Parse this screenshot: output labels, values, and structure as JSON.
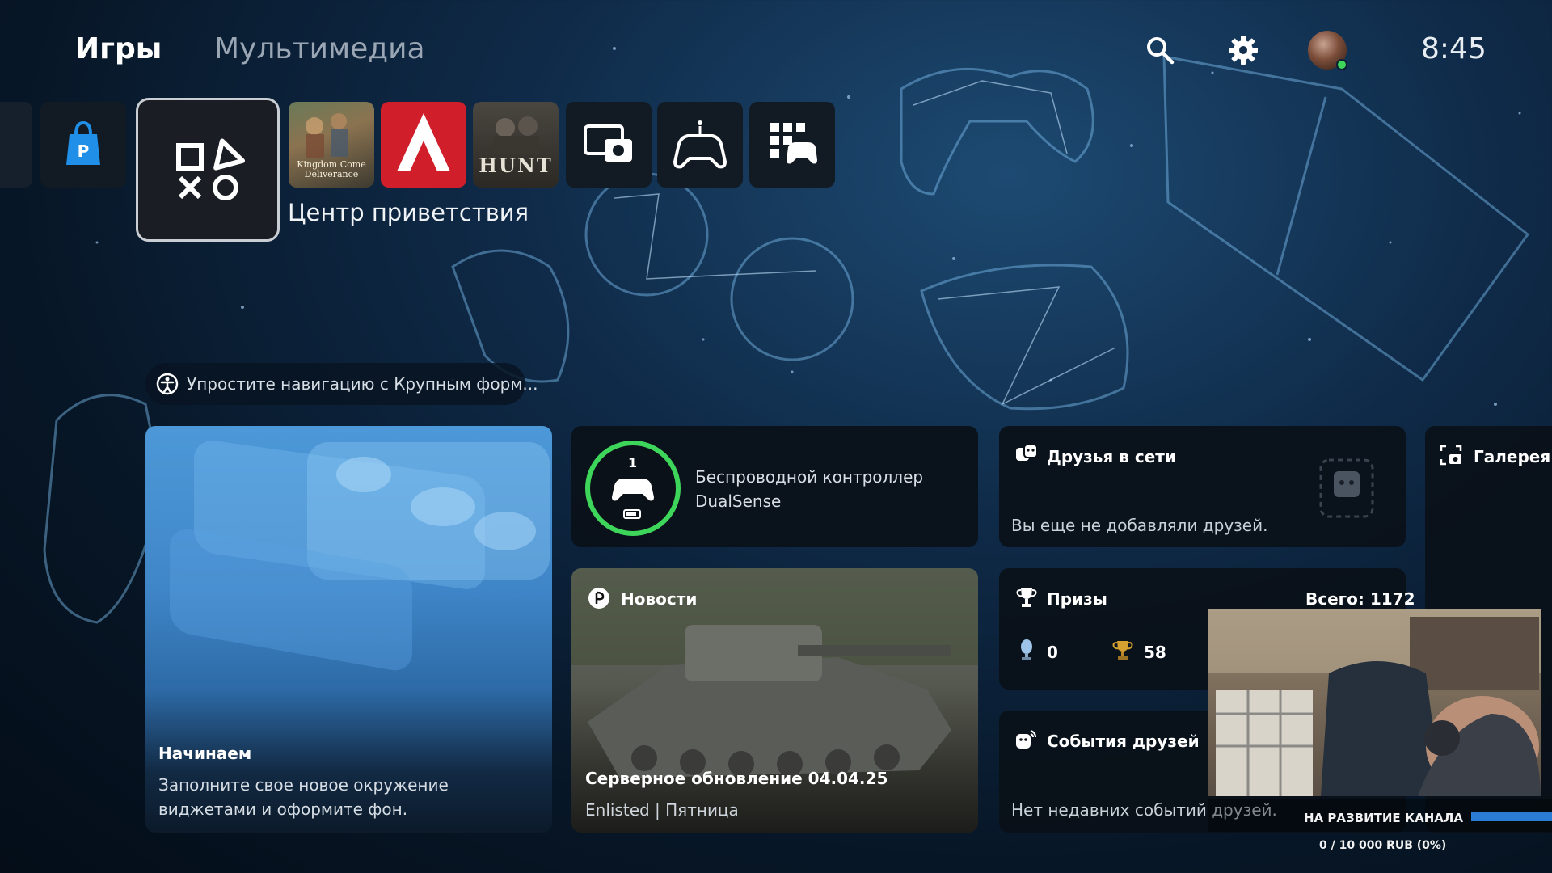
{
  "header": {
    "tabs": [
      {
        "label": "Игры",
        "active": true
      },
      {
        "label": "Мультимедиа",
        "active": false
      }
    ],
    "icons": [
      "search-icon",
      "gear-icon",
      "avatar"
    ],
    "online_color": "#3ed65a",
    "clock": "8:45"
  },
  "game_row": {
    "tiles": [
      "playstation-store",
      "game-help-center",
      "kingdom-come-deliverance",
      "assassins-creed",
      "hunt-showdown",
      "media-gallery",
      "game-controller",
      "game-library"
    ],
    "selected_label": "Центр приветствия",
    "kcd_logo_text": "Kingdom Come Deliverance",
    "hunt_logo_text": "HUNT"
  },
  "accessibility_hint": {
    "text": "Упростите навигацию с Крупным форм..."
  },
  "widgets": {
    "getting_started": {
      "title": "Начинаем",
      "description": "Заполните свое новое окружение виджетами и оформите фон."
    },
    "controller": {
      "number": "1",
      "label": "Беспроводной контроллер DualSense",
      "ring_color": "#3ed65a"
    },
    "news": {
      "header": "Новости",
      "title": "Серверное обновление 04.04.25",
      "meta": "Enlisted | Пятница"
    },
    "friends": {
      "title": "Друзья в сети",
      "empty_text": "Вы еще не добавляли друзей."
    },
    "trophies": {
      "title": "Призы",
      "total": "Всего: 1172",
      "platinum": "0",
      "gold": "58"
    },
    "friend_events": {
      "title": "События друзей",
      "empty_text": "Нет недавних событий друзей."
    },
    "gallery": {
      "title": "Галерея м"
    }
  },
  "stream_overlay": {
    "donation_label": "НА РАЗВИТИЕ КАНАЛА",
    "donation_value": "0 / 10 000 RUB (0%)",
    "donation_progress": 0
  }
}
